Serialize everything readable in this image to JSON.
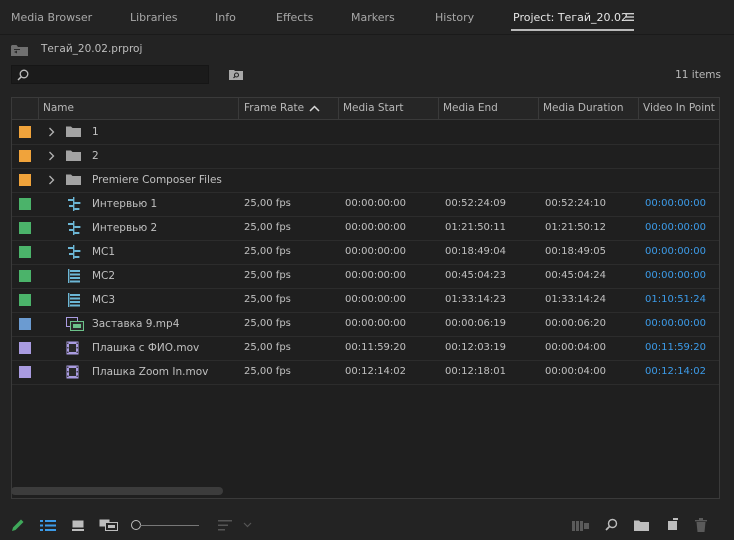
{
  "tabs": [
    {
      "label": "Media Browser"
    },
    {
      "label": "Libraries"
    },
    {
      "label": "Info"
    },
    {
      "label": "Effects"
    },
    {
      "label": "Markers"
    },
    {
      "label": "History"
    },
    {
      "label": "Project: Тегай_20.02"
    }
  ],
  "project": {
    "file_name": "Тегай_20.02.prproj"
  },
  "search": {
    "value": "",
    "icon": "search-icon"
  },
  "item_count": "11 items",
  "columns": [
    "Name",
    "Frame Rate",
    "Media Start",
    "Media End",
    "Media Duration",
    "Video In Point"
  ],
  "sort": {
    "column": "Frame Rate",
    "direction": "ascending"
  },
  "colors": {
    "orange": "#f0a33b",
    "green": "#4bb36a",
    "blue": "#6b9bd1",
    "lavender": "#a99be0",
    "accent_blue": "#3c9be8",
    "clip_icon": "#6cb7d6"
  },
  "rows": [
    {
      "label_color": "#f0a33b",
      "type": "bin",
      "expandable": true,
      "name": "1",
      "frame_rate": "",
      "media_start": "",
      "media_end": "",
      "media_duration": "",
      "video_in": ""
    },
    {
      "label_color": "#f0a33b",
      "type": "bin",
      "expandable": true,
      "name": "2",
      "frame_rate": "",
      "media_start": "",
      "media_end": "",
      "media_duration": "",
      "video_in": ""
    },
    {
      "label_color": "#f0a33b",
      "type": "bin",
      "expandable": true,
      "name": "Premiere Composer Files",
      "frame_rate": "",
      "media_start": "",
      "media_end": "",
      "media_duration": "",
      "video_in": ""
    },
    {
      "label_color": "#4bb36a",
      "type": "sequence",
      "expandable": false,
      "name": "Интервью 1",
      "frame_rate": "25,00 fps",
      "media_start": "00:00:00:00",
      "media_end": "00:52:24:09",
      "media_duration": "00:52:24:10",
      "video_in": "00:00:00:00"
    },
    {
      "label_color": "#4bb36a",
      "type": "sequence",
      "expandable": false,
      "name": "Интервью 2",
      "frame_rate": "25,00 fps",
      "media_start": "00:00:00:00",
      "media_end": "01:21:50:11",
      "media_duration": "01:21:50:12",
      "video_in": "00:00:00:00"
    },
    {
      "label_color": "#4bb36a",
      "type": "sequence",
      "expandable": false,
      "name": "MC1",
      "frame_rate": "25,00 fps",
      "media_start": "00:00:00:00",
      "media_end": "00:18:49:04",
      "media_duration": "00:18:49:05",
      "video_in": "00:00:00:00"
    },
    {
      "label_color": "#4bb36a",
      "type": "multicam",
      "expandable": false,
      "name": "MC2",
      "frame_rate": "25,00 fps",
      "media_start": "00:00:00:00",
      "media_end": "00:45:04:23",
      "media_duration": "00:45:04:24",
      "video_in": "00:00:00:00"
    },
    {
      "label_color": "#4bb36a",
      "type": "multicam",
      "expandable": false,
      "name": "MC3",
      "frame_rate": "25,00 fps",
      "media_start": "00:00:00:00",
      "media_end": "01:33:14:23",
      "media_duration": "01:33:14:24",
      "video_in": "01:10:51:24"
    },
    {
      "label_color": "#6b9bd1",
      "type": "av-clip",
      "expandable": false,
      "name": "Заставка 9.mp4",
      "frame_rate": "25,00 fps",
      "media_start": "00:00:00:00",
      "media_end": "00:00:06:19",
      "media_duration": "00:00:06:20",
      "video_in": "00:00:00:00"
    },
    {
      "label_color": "#a99be0",
      "type": "video-clip",
      "expandable": false,
      "name": "Плашка с ФИО.mov",
      "frame_rate": "25,00 fps",
      "media_start": "00:11:59:20",
      "media_end": "00:12:03:19",
      "media_duration": "00:00:04:00",
      "video_in": "00:11:59:20"
    },
    {
      "label_color": "#a99be0",
      "type": "video-clip",
      "expandable": false,
      "name": "Плашка Zoom In.mov",
      "frame_rate": "25,00 fps",
      "media_start": "00:12:14:02",
      "media_end": "00:12:18:01",
      "media_duration": "00:00:04:00",
      "video_in": "00:12:14:02"
    }
  ],
  "bottom_toolbar": {
    "icons": [
      "pencil-icon",
      "list-view-icon",
      "icon-view-icon",
      "freeform-view-icon",
      "zoom-slider",
      "sort-icons-icon",
      "automate-to-sequence-icon",
      "find-icon",
      "new-bin-icon",
      "new-item-icon",
      "clear-icon"
    ],
    "zoom_value": 0
  }
}
